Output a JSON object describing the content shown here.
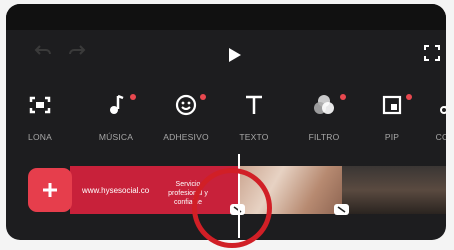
{
  "toolbar": {
    "items": [
      {
        "label": "LONA",
        "icon": "canvas-icon",
        "badge": false
      },
      {
        "label": "MÚSICA",
        "icon": "music-icon",
        "badge": true
      },
      {
        "label": "ADHESIVO",
        "icon": "sticker-icon",
        "badge": true
      },
      {
        "label": "TEXTO",
        "icon": "text-icon",
        "badge": false
      },
      {
        "label": "FILTRO",
        "icon": "filter-icon",
        "badge": true
      },
      {
        "label": "PIP",
        "icon": "pip-icon",
        "badge": true
      },
      {
        "label": "CORT",
        "icon": "cut-icon",
        "badge": false
      }
    ]
  },
  "timeline": {
    "clip1_text": "www.hysesocial.co",
    "clip1_subtext": "Servicio profesional y confiable"
  },
  "colors": {
    "accent": "#e63e4c",
    "highlight_circle": "#d11f26",
    "badge": "#e8484f"
  }
}
